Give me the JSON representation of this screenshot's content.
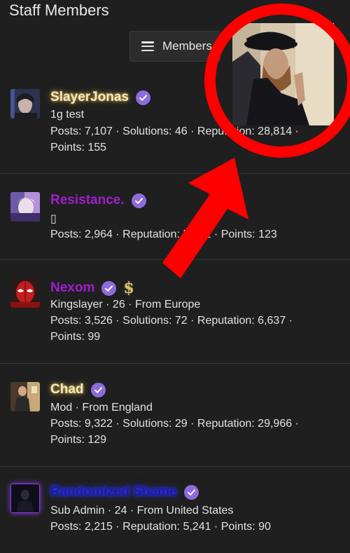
{
  "header": {
    "title": "Staff Members",
    "menu_label": "Members"
  },
  "members": [
    {
      "name": "SlayerJonas",
      "line1": "1g test",
      "line2": "Posts: 7,107 · Solutions: 46 · Reputation: 28,814 ·",
      "line3": "Points: 155"
    },
    {
      "name": "Resistance.",
      "line1": "▯",
      "line2": "Posts: 2,964 · Reputation: 5,092 · Points: 123"
    },
    {
      "name": "Nexom",
      "line1": "Kingslayer · 26 · From Europe",
      "line2": "Posts: 3,526 · Solutions: 72 · Reputation: 6,637 ·",
      "line3": "Points: 99"
    },
    {
      "name": "Chad",
      "line1": "Mod · From England",
      "line2": "Posts: 9,322 · Solutions: 29 · Reputation: 29,966 ·",
      "line3": "Points: 129"
    },
    {
      "name": "Randomized Shame",
      "line1": "Sub Admin · 24 · From United States",
      "line2": "Posts: 2,215 · Reputation: 5,241 · Points: 90"
    }
  ],
  "colors": {
    "background": "#1f1f1f",
    "verified_badge": "#8e6bdc",
    "name_purple": "#a11ecf",
    "name_gold_glow": "#c9a94a",
    "name_blue": "#1b1aa8",
    "annotation_red": "#ff0000"
  },
  "icons": {
    "menu": "hamburger-icon",
    "verified": "verified-check-icon",
    "dollar": "dollar-sign-icon"
  }
}
